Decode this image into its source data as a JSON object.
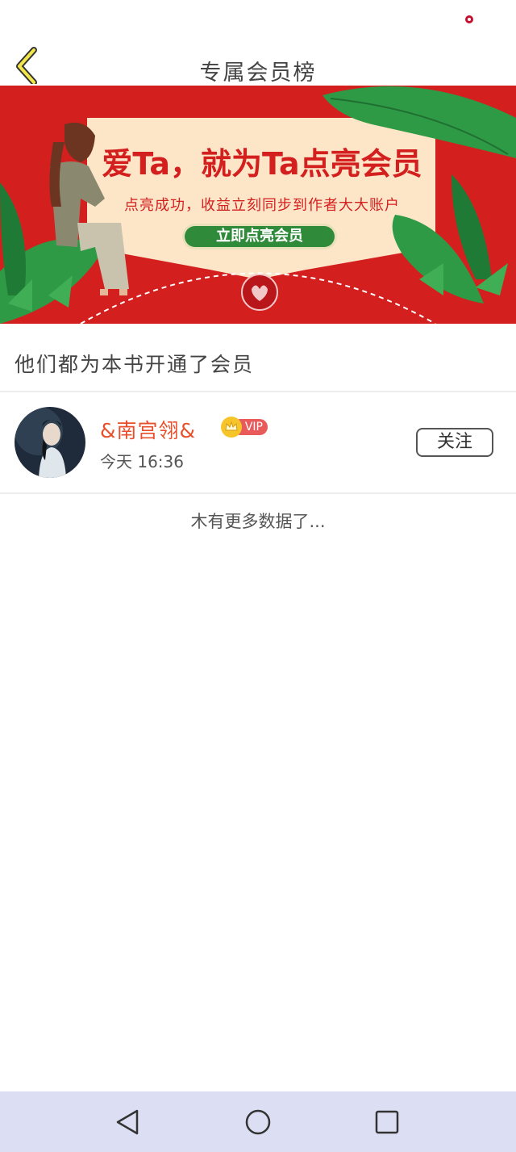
{
  "header": {
    "title": "专属会员榜"
  },
  "banner": {
    "headline": "爱Ta，就为Ta点亮会员",
    "subline": "点亮成功，收益立刻同步到作者大大账户",
    "cta_label": "立即点亮会员",
    "colors": {
      "background": "#d41f1f",
      "card": "#fde6c8",
      "leaf": "#2e9a45",
      "cta": "#2f8a3a"
    }
  },
  "section": {
    "heading": "他们都为本书开通了会员"
  },
  "members": [
    {
      "name": "&南宫翎&",
      "badge": "VIP",
      "time": "今天 16:36",
      "follow_label": "关注"
    }
  ],
  "list_end_text": "木有更多数据了...",
  "nav": {
    "icons": [
      "back-triangle-icon",
      "home-circle-icon",
      "recents-square-icon"
    ]
  }
}
